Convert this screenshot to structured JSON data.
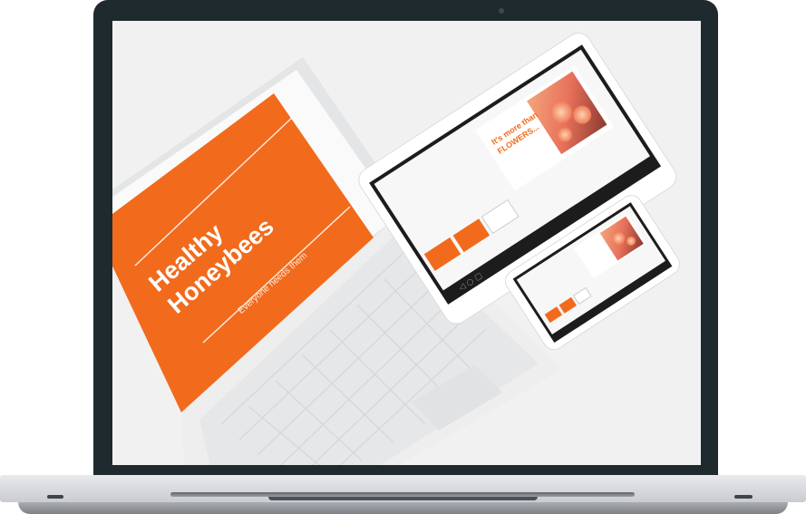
{
  "slide": {
    "title_line1": "Healthy",
    "title_line2": "Honeybees",
    "subtitle": "Everyone needs them"
  },
  "tablet_slide": {
    "heading_line1": "It's more than",
    "heading_line2": "FLOWERS..."
  },
  "colors": {
    "accent": "#f26a1b",
    "bezel": "#1f2a2e",
    "screen_bg": "#f1f1f1"
  }
}
